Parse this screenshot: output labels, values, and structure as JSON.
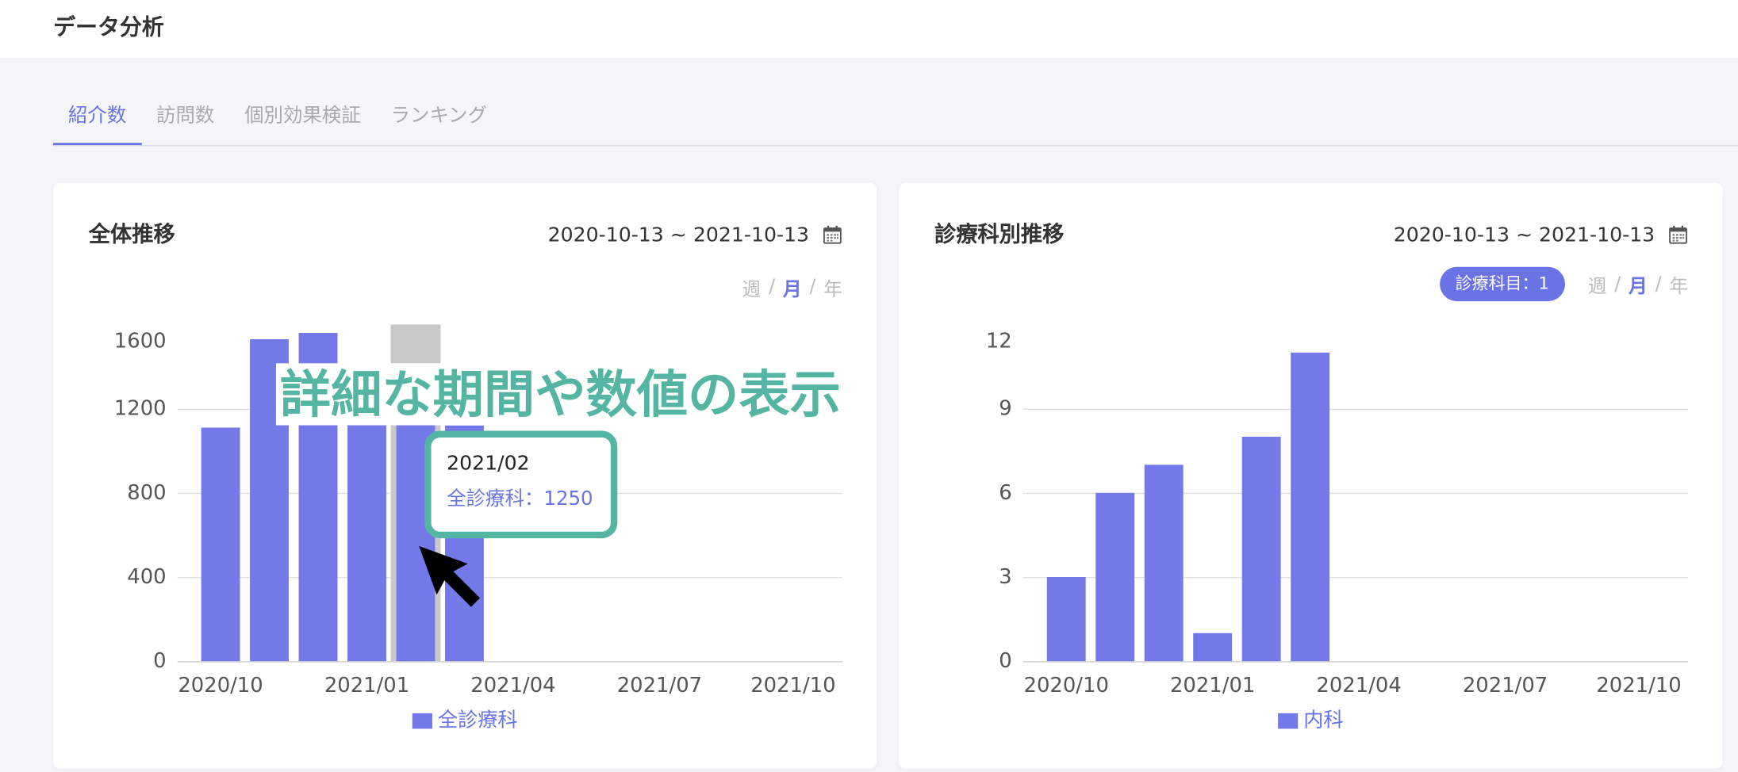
{
  "header": {
    "title": "データ分析"
  },
  "tabs": {
    "items": [
      "紹介数",
      "訪問数",
      "個別効果検証",
      "ランキング"
    ],
    "active_index": 0
  },
  "colors": {
    "accent": "#6a73e6",
    "bar": "#7479ea",
    "annotation": "#55b5a3",
    "page_background": "#f5f6fa",
    "hover_highlight": "#c9c9c9",
    "gridline": "#e0e0e0",
    "axis_line": "#cccccc"
  },
  "cards": {
    "overall": {
      "title": "全体推移",
      "date_range": "2020-10-13 ~ 2021-10-13",
      "date_icon": "calendar-icon",
      "period": {
        "options": [
          "週",
          "月",
          "年"
        ],
        "separator": "/",
        "selected_index": 1
      },
      "tooltip": {
        "title": "2021/02",
        "label": "全診療科：1250"
      }
    },
    "by_department": {
      "title": "診療科別推移",
      "date_range": "2020-10-13 ~ 2021-10-13",
      "date_icon": "calendar-icon",
      "filter_badge": "診療科目：1",
      "period": {
        "options": [
          "週",
          "月",
          "年"
        ],
        "separator": "/",
        "selected_index": 1
      }
    }
  },
  "annotation": {
    "text": "詳細な期間や数値の表示",
    "pointer_icon": "cursor-arrow-icon"
  },
  "chart_data": [
    {
      "type": "bar",
      "x": [
        "2020/10",
        "2020/11",
        "2020/12",
        "2021/01",
        "2021/02",
        "2021/03"
      ],
      "series": [
        {
          "name": "全診療科",
          "values": [
            1110,
            1530,
            1560,
            1300,
            1250,
            1120
          ]
        }
      ],
      "xlim": [
        "2020/10",
        "2021/10"
      ],
      "xticks": [
        "2020/10",
        "2021/01",
        "2021/04",
        "2021/07",
        "2021/10"
      ],
      "ylim": [
        0,
        1600
      ],
      "yticks": [
        0,
        400,
        800,
        1200,
        1600
      ],
      "grid": true,
      "legend": "bottom",
      "highlighted": "2021/02"
    },
    {
      "type": "bar",
      "x": [
        "2020/10",
        "2020/11",
        "2020/12",
        "2021/01",
        "2021/02",
        "2021/03"
      ],
      "series": [
        {
          "name": "内科",
          "values": [
            3,
            6,
            7,
            1,
            8,
            11
          ]
        }
      ],
      "xlim": [
        "2020/10",
        "2021/10"
      ],
      "xticks": [
        "2020/10",
        "2021/01",
        "2021/04",
        "2021/07",
        "2021/10"
      ],
      "ylim": [
        0,
        12
      ],
      "yticks": [
        0,
        3,
        6,
        9,
        12
      ],
      "grid": true,
      "legend": "bottom"
    }
  ]
}
